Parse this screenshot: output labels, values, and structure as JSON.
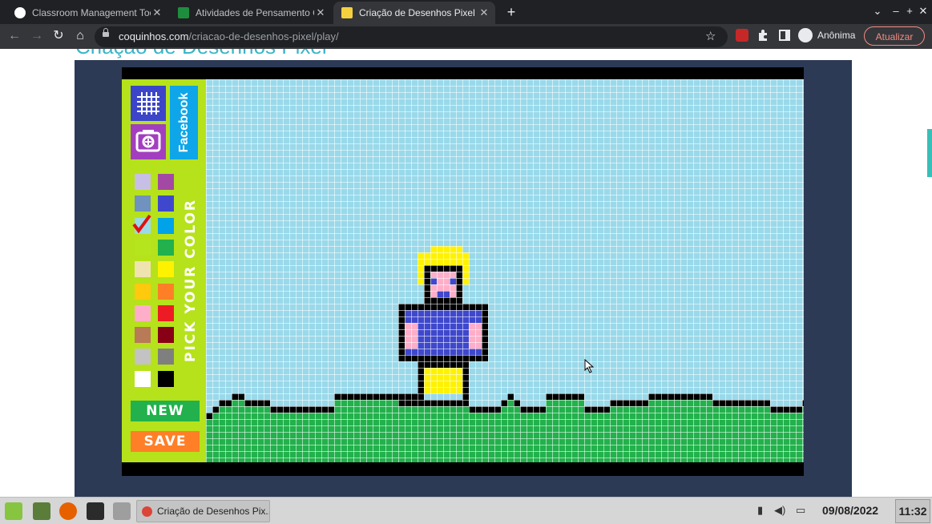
{
  "browser": {
    "tabs": [
      {
        "title": "Classroom Management Too",
        "favicon": "google-icon",
        "active": false
      },
      {
        "title": "Atividades de Pensamento Co",
        "favicon": "classroom-icon",
        "active": false
      },
      {
        "title": "Criação de Desenhos Pixel | C",
        "favicon": "coquinhos-icon",
        "active": true
      }
    ],
    "new_tab_symbol": "+",
    "window_controls": [
      "⌄",
      "–",
      "+",
      "✕"
    ],
    "url_domain": "coquinhos.com",
    "url_path": "/criacao-de-desenhos-pixel/play/",
    "profile_label": "Anônima",
    "update_label": "Atualizar"
  },
  "page": {
    "title": "Criação de Desenhos Pixel"
  },
  "game": {
    "facebook_label": "Facebook",
    "pick_label": "PICK YOUR COLOR",
    "new_label": "NEW",
    "save_label": "SAVE",
    "selected_color": "#99d9ea",
    "palette": [
      [
        "#c8bfe7",
        "#a349a4"
      ],
      [
        "#7092be",
        "#3f48cc"
      ],
      [
        "#99d9ea",
        "#00a2e8"
      ],
      [
        "#b5e61d",
        "#22b14c"
      ],
      [
        "#efe4b0",
        "#fff200"
      ],
      [
        "#ffc90e",
        "#ff7f27"
      ],
      [
        "#ffaec9",
        "#ed1c24"
      ],
      [
        "#b97a57",
        "#880015"
      ],
      [
        "#c3c3c3",
        "#7f7f7f"
      ],
      [
        "#ffffff",
        "#000000"
      ]
    ],
    "sky_color": "#99d9ea",
    "grass_color": "#22b14c"
  },
  "taskbar": {
    "window_title": "Criação de Desenhos Pix...",
    "date": "09/08/2022",
    "time": "11:32"
  }
}
